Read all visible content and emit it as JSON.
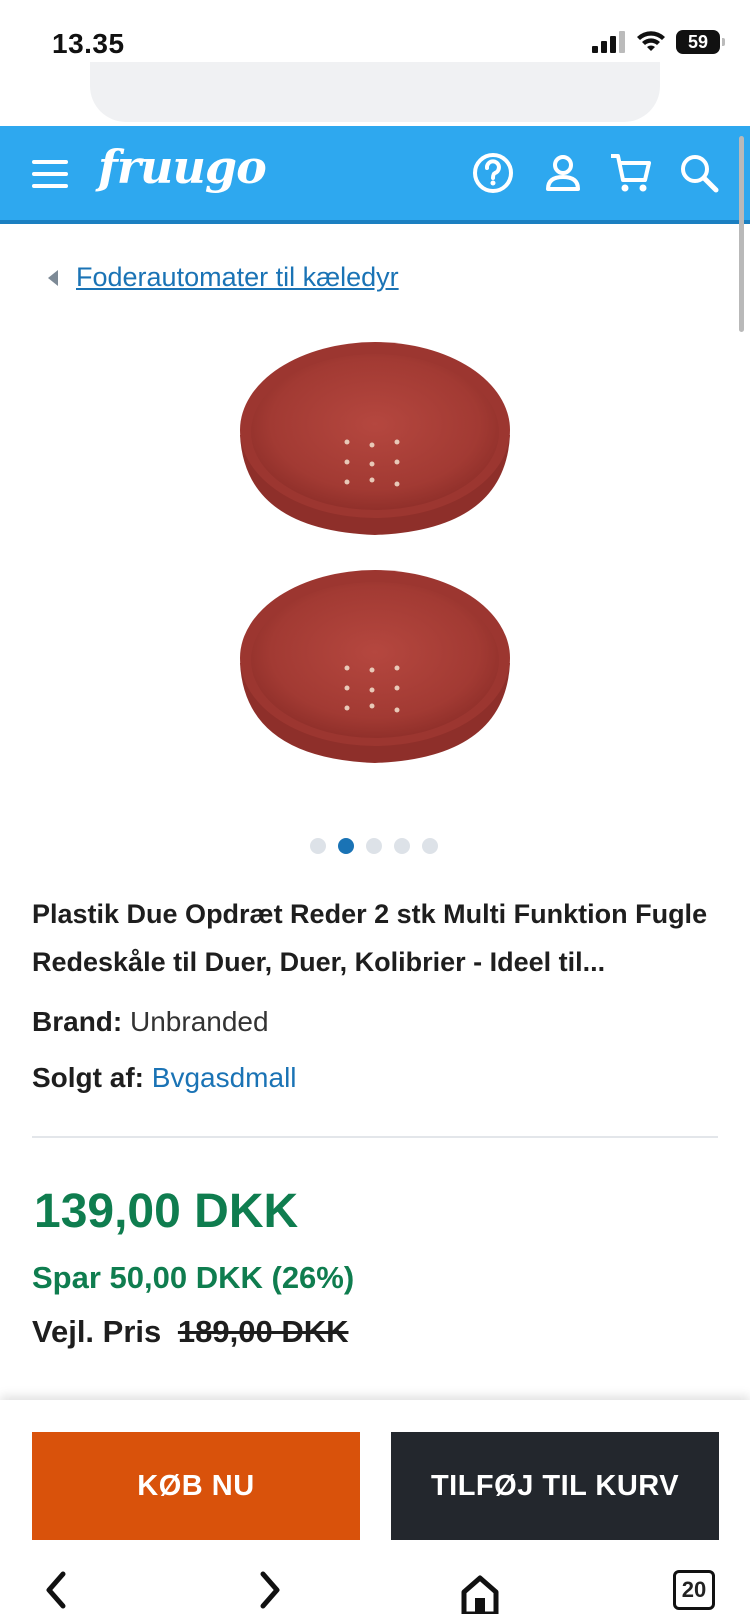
{
  "status_bar": {
    "time": "13.35",
    "battery": "59"
  },
  "header": {
    "logo": "fruugo"
  },
  "breadcrumb": {
    "label": "Foderautomater til kæledyr"
  },
  "product": {
    "title": "Plastik Due Opdræt Reder 2 stk Multi Funktion Fugle Redeskåle til Duer, Duer, Kolibrier - Ideel til...",
    "brand_label": "Brand:",
    "brand_value": "Unbranded",
    "seller_label": "Solgt af:",
    "seller_value": "Bvgasdmall",
    "image_count": 5,
    "active_image": 2,
    "bowl_color": "#a33a33"
  },
  "pricing": {
    "price": "139,00 DKK",
    "savings": "Spar 50,00 DKK (26%)",
    "rrp_label": "Vejl. Pris",
    "rrp_value": "189,00 DKK"
  },
  "actions": {
    "buy_now": "KØB NU",
    "add_to_cart": "TILFØJ TIL KURV"
  },
  "browser": {
    "tab_count": "20"
  },
  "colors": {
    "header": "#2ea8ef",
    "link": "#1a73b5",
    "price": "#0f7d4f",
    "buy": "#d9520b",
    "cart": "#23272d"
  }
}
